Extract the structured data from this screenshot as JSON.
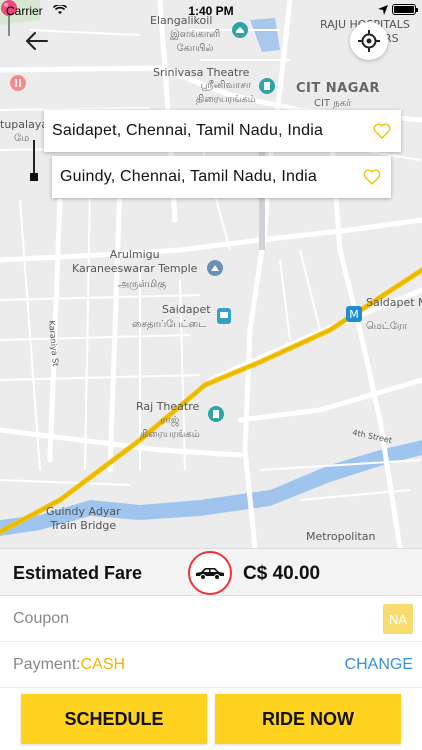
{
  "status_bar": {
    "carrier": "Carrier",
    "time": "1:40 PM"
  },
  "map": {
    "labels": {
      "elangalikoil": "Elangalikoil",
      "elangalikoil_tamil": "இளங்காளி\nகோயில்",
      "raju_hospitals": "RAJU HOSPITALS",
      "raju_hospitals_frag": "RS",
      "srinivasa_theatre": "Srinivasa Theatre",
      "srinivasa_tamil": "ஸ்ரீனிவாசா\nதிரையரங்கம்",
      "cit_nagar": "CIT NAGAR",
      "cit_nagar_tamil": "CIT நகர்",
      "kotturpuram": "tupalaya",
      "kotturpuram_frag": "மே",
      "arulmigu": "Arulmigu\nKaraneeswarar Temple",
      "arulmigu_tamil": "அருள்மிகு",
      "saidapet": "Saidapet",
      "saidapet_tamil": "சைதாப்பேட்டை",
      "saidapet_metro": "Saidapet M",
      "saidapet_metro_tamil": "மெட்ரோ",
      "raj_theatre": "Raj Theatre",
      "raj_theatre_tamil": "ராஜ்\nதிரையரங்கம்",
      "karaniya_st": "Karaniya St",
      "fourth_street": "4th Street",
      "guindy_adyar": "Guindy Adyar\nTrain Bridge",
      "metropolitan": "Metropolitan"
    }
  },
  "pickup": {
    "address": "Saidapet, Chennai, Tamil Nadu, India"
  },
  "drop": {
    "address": "Guindy, Chennai, Tamil Nadu, India"
  },
  "fare": {
    "label": "Estimated Fare",
    "amount": "C$ 40.00"
  },
  "coupon": {
    "label": "Coupon",
    "badge": "NA"
  },
  "payment": {
    "label": "Payment:",
    "value": "CASH",
    "change_label": "CHANGE"
  },
  "actions": {
    "schedule_label": "SCHEDULE",
    "ride_now_label": "RIDE NOW"
  },
  "colors": {
    "accent_yellow": "#ffd21f",
    "link_blue": "#3a8edb",
    "pin_pink": "#e94c7a",
    "road_yellow": "#f2c200"
  },
  "icons": {
    "back": "arrow-left-icon",
    "locate": "crosshair-icon",
    "favorite": "heart-outline-icon",
    "car": "car-icon",
    "pin": "map-pin-icon"
  }
}
